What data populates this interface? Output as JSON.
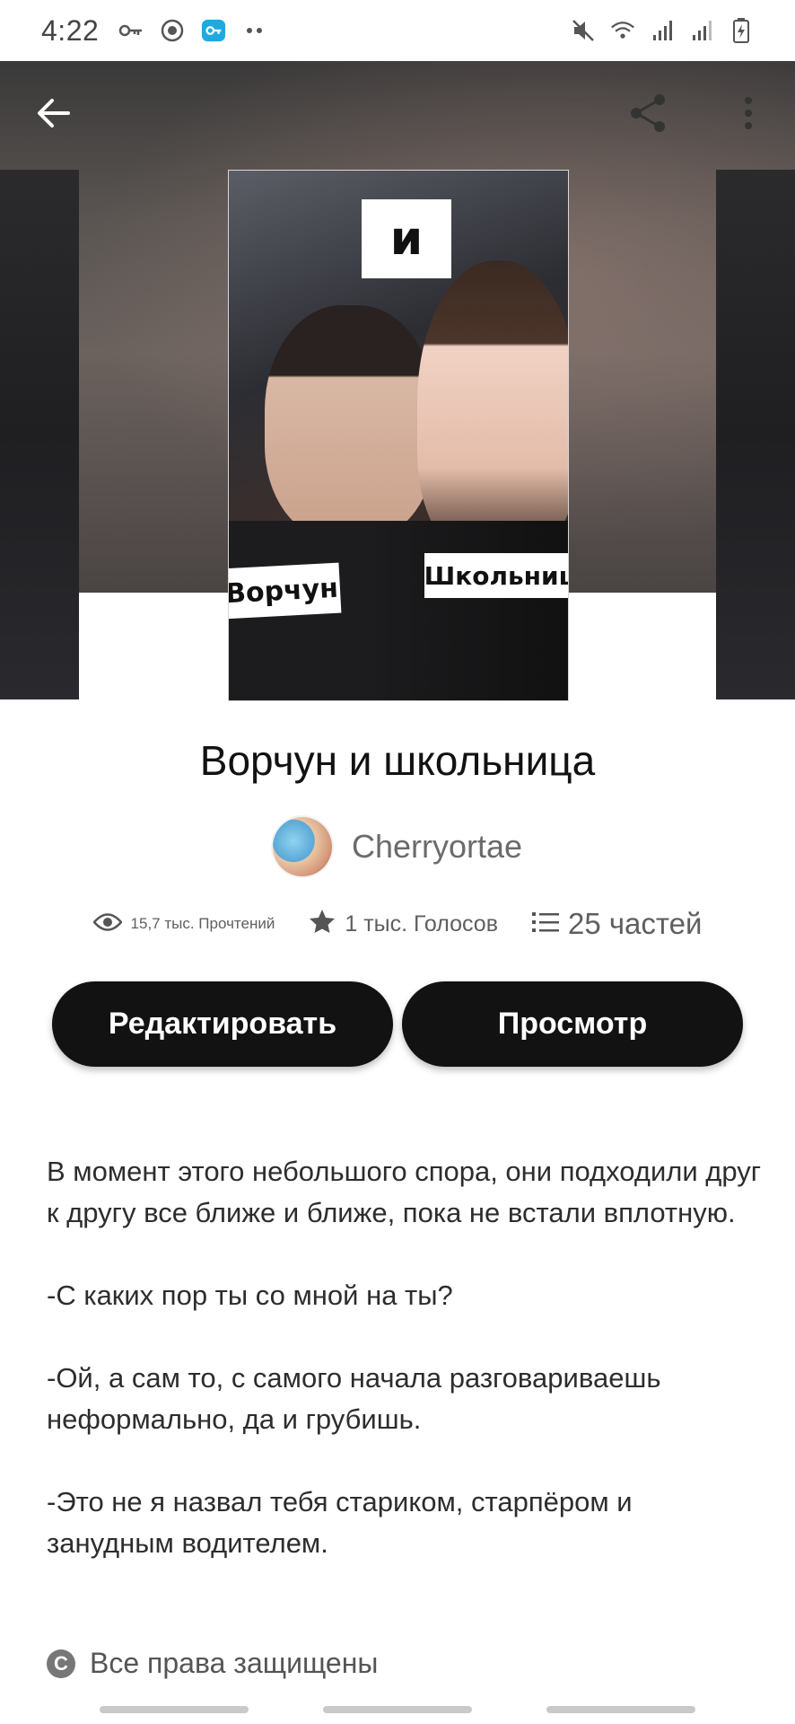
{
  "status_bar": {
    "time": "4:22",
    "left_icons": [
      "key-icon",
      "lion-icon",
      "vpn-key-icon",
      "more-dots-icon"
    ],
    "right_icons": [
      "mute-icon",
      "wifi-icon",
      "signal-icon",
      "signal-icon-2",
      "battery-icon"
    ]
  },
  "header": {
    "back_icon": "arrow-left-icon",
    "share_icon": "share-icon",
    "menu_icon": "more-vertical-icon"
  },
  "cover": {
    "label_and": "и",
    "label_grumpy": "Ворчун",
    "label_student": "Школьниц"
  },
  "story": {
    "title": "Ворчун и школьница",
    "author": "Cherryortae",
    "stats": {
      "reads": "15,7 тыс. Прочтений",
      "votes": "1 тыс. Голосов",
      "parts": "25 частей"
    }
  },
  "actions": {
    "edit_label": "Редактировать",
    "view_label": "Просмотр"
  },
  "description": {
    "paragraphs": [
      "В момент этого небольшого спора, они подходили друг к другу все ближе и ближе, пока не встали вплотную.",
      "-С каких пор ты со мной на ты?",
      "-Ой, а сам то, с самого начала разговариваешь неформально, да и грубишь.",
      "-Это не я назвал тебя стариком, старпёром и занудным водителем."
    ]
  },
  "footer": {
    "copyright": "Все права защищены",
    "copyright_symbol": "C"
  },
  "colors": {
    "button_bg": "#121212",
    "button_text": "#ffffff",
    "muted_text": "#6b6b6b"
  }
}
